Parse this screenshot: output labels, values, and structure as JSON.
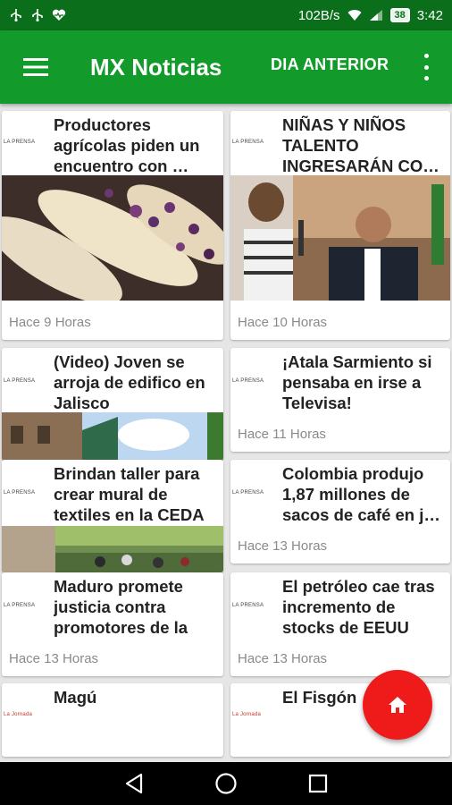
{
  "status_bar": {
    "speed": "102B/s",
    "battery": "38",
    "time": "3:42"
  },
  "app_bar": {
    "title": "MX Noticias",
    "previous_day_label": "DIA ANTERIOR"
  },
  "cards": [
    {
      "source": "LA PRENSA",
      "title": "Productores agrícolas piden un encuentro con …",
      "time": "Hace 9 Horas",
      "image": "corn-photo"
    },
    {
      "source": "LA PRENSA",
      "title": "NIÑAS Y NIÑOS TALENTO INGRESARÁN CO…",
      "time": "Hace 10 Horas",
      "image": "event-photo"
    },
    {
      "source": "LA PRENSA",
      "title": "(Video) Joven se arroja de edifico en Jalisco",
      "time": "",
      "image": "building-photo"
    },
    {
      "source": "LA PRENSA",
      "title": "¡Atala Sarmiento si pensaba en irse a Televisa!",
      "time": "Hace 11 Horas",
      "image": ""
    },
    {
      "source": "LA PRENSA",
      "title": "Brindan taller para crear mural de textiles en la CEDA",
      "time": "",
      "image": "street-photo"
    },
    {
      "source": "LA PRENSA",
      "title": "Colombia produjo 1,87 millones de sacos de café en j…",
      "time": "Hace 13 Horas",
      "image": ""
    },
    {
      "source": "LA PRENSA",
      "title": "Maduro promete justicia contra promotores de la “…",
      "time": "Hace 13 Horas",
      "image": ""
    },
    {
      "source": "LA PRENSA",
      "title": "El petróleo cae tras incremento de stocks de EEUU",
      "time": "Hace 13 Horas",
      "image": ""
    },
    {
      "source": "La Jornada",
      "title": "Magú",
      "time": "",
      "image": ""
    },
    {
      "source": "La Jornada",
      "title": "El Fisgón",
      "time": "",
      "image": ""
    }
  ],
  "colors": {
    "status_bar": "#0b6e1a",
    "app_bar": "#129b2a",
    "fab": "#ef1b1b",
    "background": "#e6e6e6"
  },
  "icons": {
    "menu": "hamburger-menu-icon",
    "more": "overflow-menu-icon",
    "fab": "home-icon",
    "nav": [
      "back-icon",
      "home-circle-icon",
      "recents-icon"
    ]
  }
}
